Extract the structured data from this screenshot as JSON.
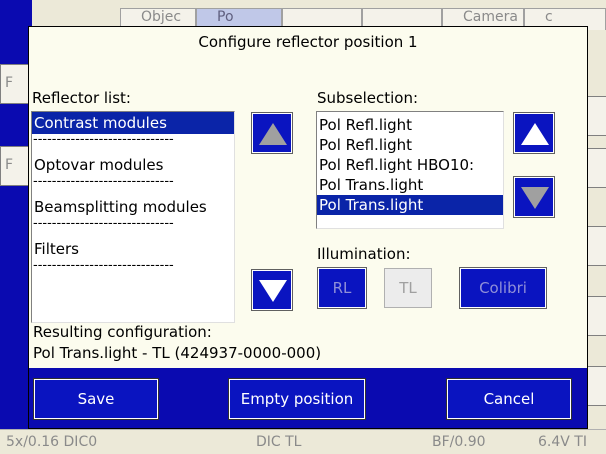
{
  "background": {
    "tabs": [
      "Objec",
      "Po",
      "",
      "",
      "Camera",
      "c"
    ],
    "status": [
      "5x/0.16 DIC0",
      "DIC TL",
      "BF/0.90",
      "6.4V TI"
    ],
    "left_stubs": [
      "F",
      "F"
    ]
  },
  "dialog": {
    "title": "Configure reflector position 1",
    "reflector_list_label": "Reflector list:",
    "reflector_list": [
      {
        "label": "Contrast modules",
        "selected": true
      },
      {
        "label": "Optovar modules",
        "selected": false
      },
      {
        "label": "Beamsplitting modules",
        "selected": false
      },
      {
        "label": "Filters",
        "selected": false
      }
    ],
    "separator": "------------------------------",
    "subselection_label": "Subselection:",
    "subselection": [
      {
        "label": "Pol Refl.light",
        "selected": false
      },
      {
        "label": "Pol Refl.light",
        "selected": false
      },
      {
        "label": "Pol Refl.light HBO10:",
        "selected": false
      },
      {
        "label": "Pol Trans.light",
        "selected": false
      },
      {
        "label": "Pol Trans.light",
        "selected": true
      }
    ],
    "illumination_label": "Illumination:",
    "illumination_buttons": {
      "rl": "RL",
      "tl": "TL",
      "colibri": "Colibri"
    },
    "result_label": "Resulting configuration:",
    "result_value": "Pol Trans.light  - TL (424937-0000-000)",
    "buttons": {
      "save": "Save",
      "empty": "Empty position",
      "cancel": "Cancel"
    }
  }
}
